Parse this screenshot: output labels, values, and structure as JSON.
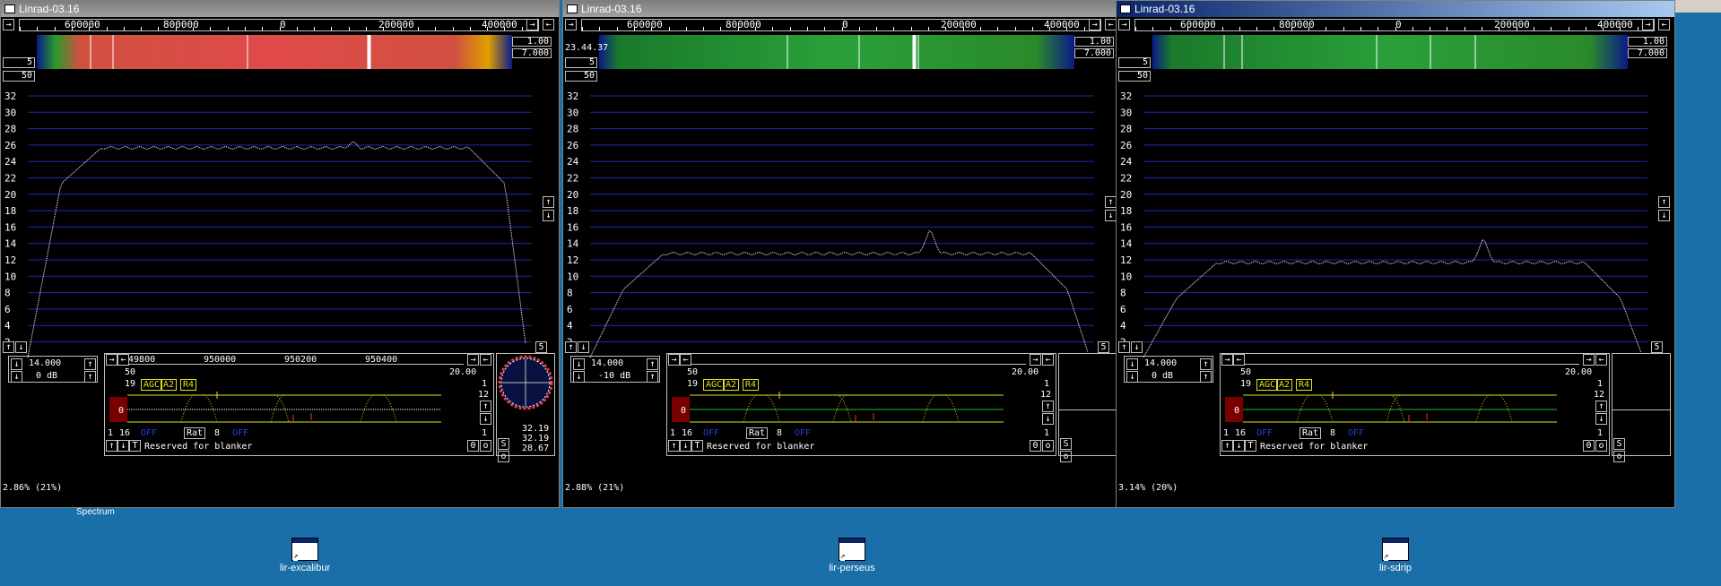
{
  "desktop": {
    "clipped_label": "Spectrum",
    "icons": [
      {
        "label": "lir-excalibur"
      },
      {
        "label": "lir-perseus"
      },
      {
        "label": "lir-sdrip"
      }
    ]
  },
  "windows": [
    {
      "title": "Linrad-03.16",
      "active": false,
      "freq_labels": [
        "600000",
        "800000",
        "0",
        "200000",
        "400000"
      ],
      "wf_top": "1.00",
      "wf_bottom": "7.000",
      "wf_left": "5",
      "wf_time": "",
      "avg_box": "50",
      "y_axis": [
        "32",
        "30",
        "28",
        "26",
        "24",
        "22",
        "20",
        "18",
        "16",
        "14",
        "12",
        "10",
        "8",
        "6",
        "4",
        "2"
      ],
      "scale_box": "5",
      "gain": "14.000",
      "db": "0 dB",
      "baseband_freqs": [
        "949800",
        "950000",
        "950200",
        "950400"
      ],
      "bb_left": "50",
      "bb_right": "20.00",
      "bb_nr": "19",
      "agc": [
        "AGC",
        "A2",
        "R4"
      ],
      "bb_1": "1",
      "bb_12": "12",
      "bb_0": "0",
      "bb_row1": [
        "1",
        "16"
      ],
      "off_a": "OFF",
      "rat": "Rat",
      "rat_val": "8",
      "off_b": "OFF",
      "reserved": "Reserved for blanker",
      "bottom_zero": "0",
      "bottom_o": "o",
      "bottom_one": "1",
      "stats": "2.86%   (21%)",
      "meter": [
        "32.19",
        "32.19",
        "28.67"
      ],
      "s_label": "S",
      "o_label": "o",
      "trace": "flat_high",
      "colors": {
        "waterfall": "red"
      }
    },
    {
      "title": "Linrad-03.16",
      "active": false,
      "freq_labels": [
        "600000",
        "800000",
        "0",
        "200000",
        "400000"
      ],
      "wf_top": "1.00",
      "wf_bottom": "7.000",
      "wf_left": "5",
      "wf_time": "23.44.37",
      "avg_box": "50",
      "y_axis": [
        "32",
        "30",
        "28",
        "26",
        "24",
        "22",
        "20",
        "18",
        "16",
        "14",
        "12",
        "10",
        "8",
        "6",
        "4",
        "2"
      ],
      "scale_box": "5",
      "gain": "14.000",
      "db": "-10 dB",
      "baseband_freqs": [],
      "bb_left": "50",
      "bb_right": "20.00",
      "bb_nr": "19",
      "agc": [
        "AGC",
        "A2",
        "R4"
      ],
      "bb_1": "1",
      "bb_12": "12",
      "bb_0": "0",
      "bb_row1": [
        "1",
        "16"
      ],
      "off_a": "OFF",
      "rat": "Rat",
      "rat_val": "8",
      "off_b": "OFF",
      "reserved": "Reserved for blanker",
      "bottom_zero": "0",
      "bottom_o": "o",
      "bottom_one": "1",
      "stats": "2.88%   (21%)",
      "meter": [],
      "s_label": "S",
      "o_label": "o",
      "trace": "flat_mid",
      "colors": {
        "waterfall": "green"
      }
    },
    {
      "title": "Linrad-03.16",
      "active": true,
      "freq_labels": [
        "600000",
        "800000",
        "0",
        "200000",
        "400000"
      ],
      "wf_top": "1.00",
      "wf_bottom": "7.000",
      "wf_left": "5",
      "wf_time": "",
      "avg_box": "50",
      "y_axis": [
        "32",
        "30",
        "28",
        "26",
        "24",
        "22",
        "20",
        "18",
        "16",
        "14",
        "12",
        "10",
        "8",
        "6",
        "4",
        "2"
      ],
      "scale_box": "5",
      "gain": "14.000",
      "db": "0 dB",
      "baseband_freqs": [],
      "bb_left": "50",
      "bb_right": "20.00",
      "bb_nr": "19",
      "agc": [
        "AGC",
        "A2",
        "R4"
      ],
      "bb_1": "1",
      "bb_12": "12",
      "bb_0": "0",
      "bb_row1": [
        "1",
        "16"
      ],
      "off_a": "OFF",
      "rat": "Rat",
      "rat_val": "8",
      "off_b": "OFF",
      "reserved": "Reserved for blanker",
      "bottom_zero": "0",
      "bottom_o": "o",
      "bottom_one": "1",
      "stats": "3.14%   (20%)",
      "meter": [],
      "s_label": "S",
      "o_label": "o",
      "trace": "flat_low",
      "colors": {
        "waterfall": "green"
      }
    }
  ]
}
